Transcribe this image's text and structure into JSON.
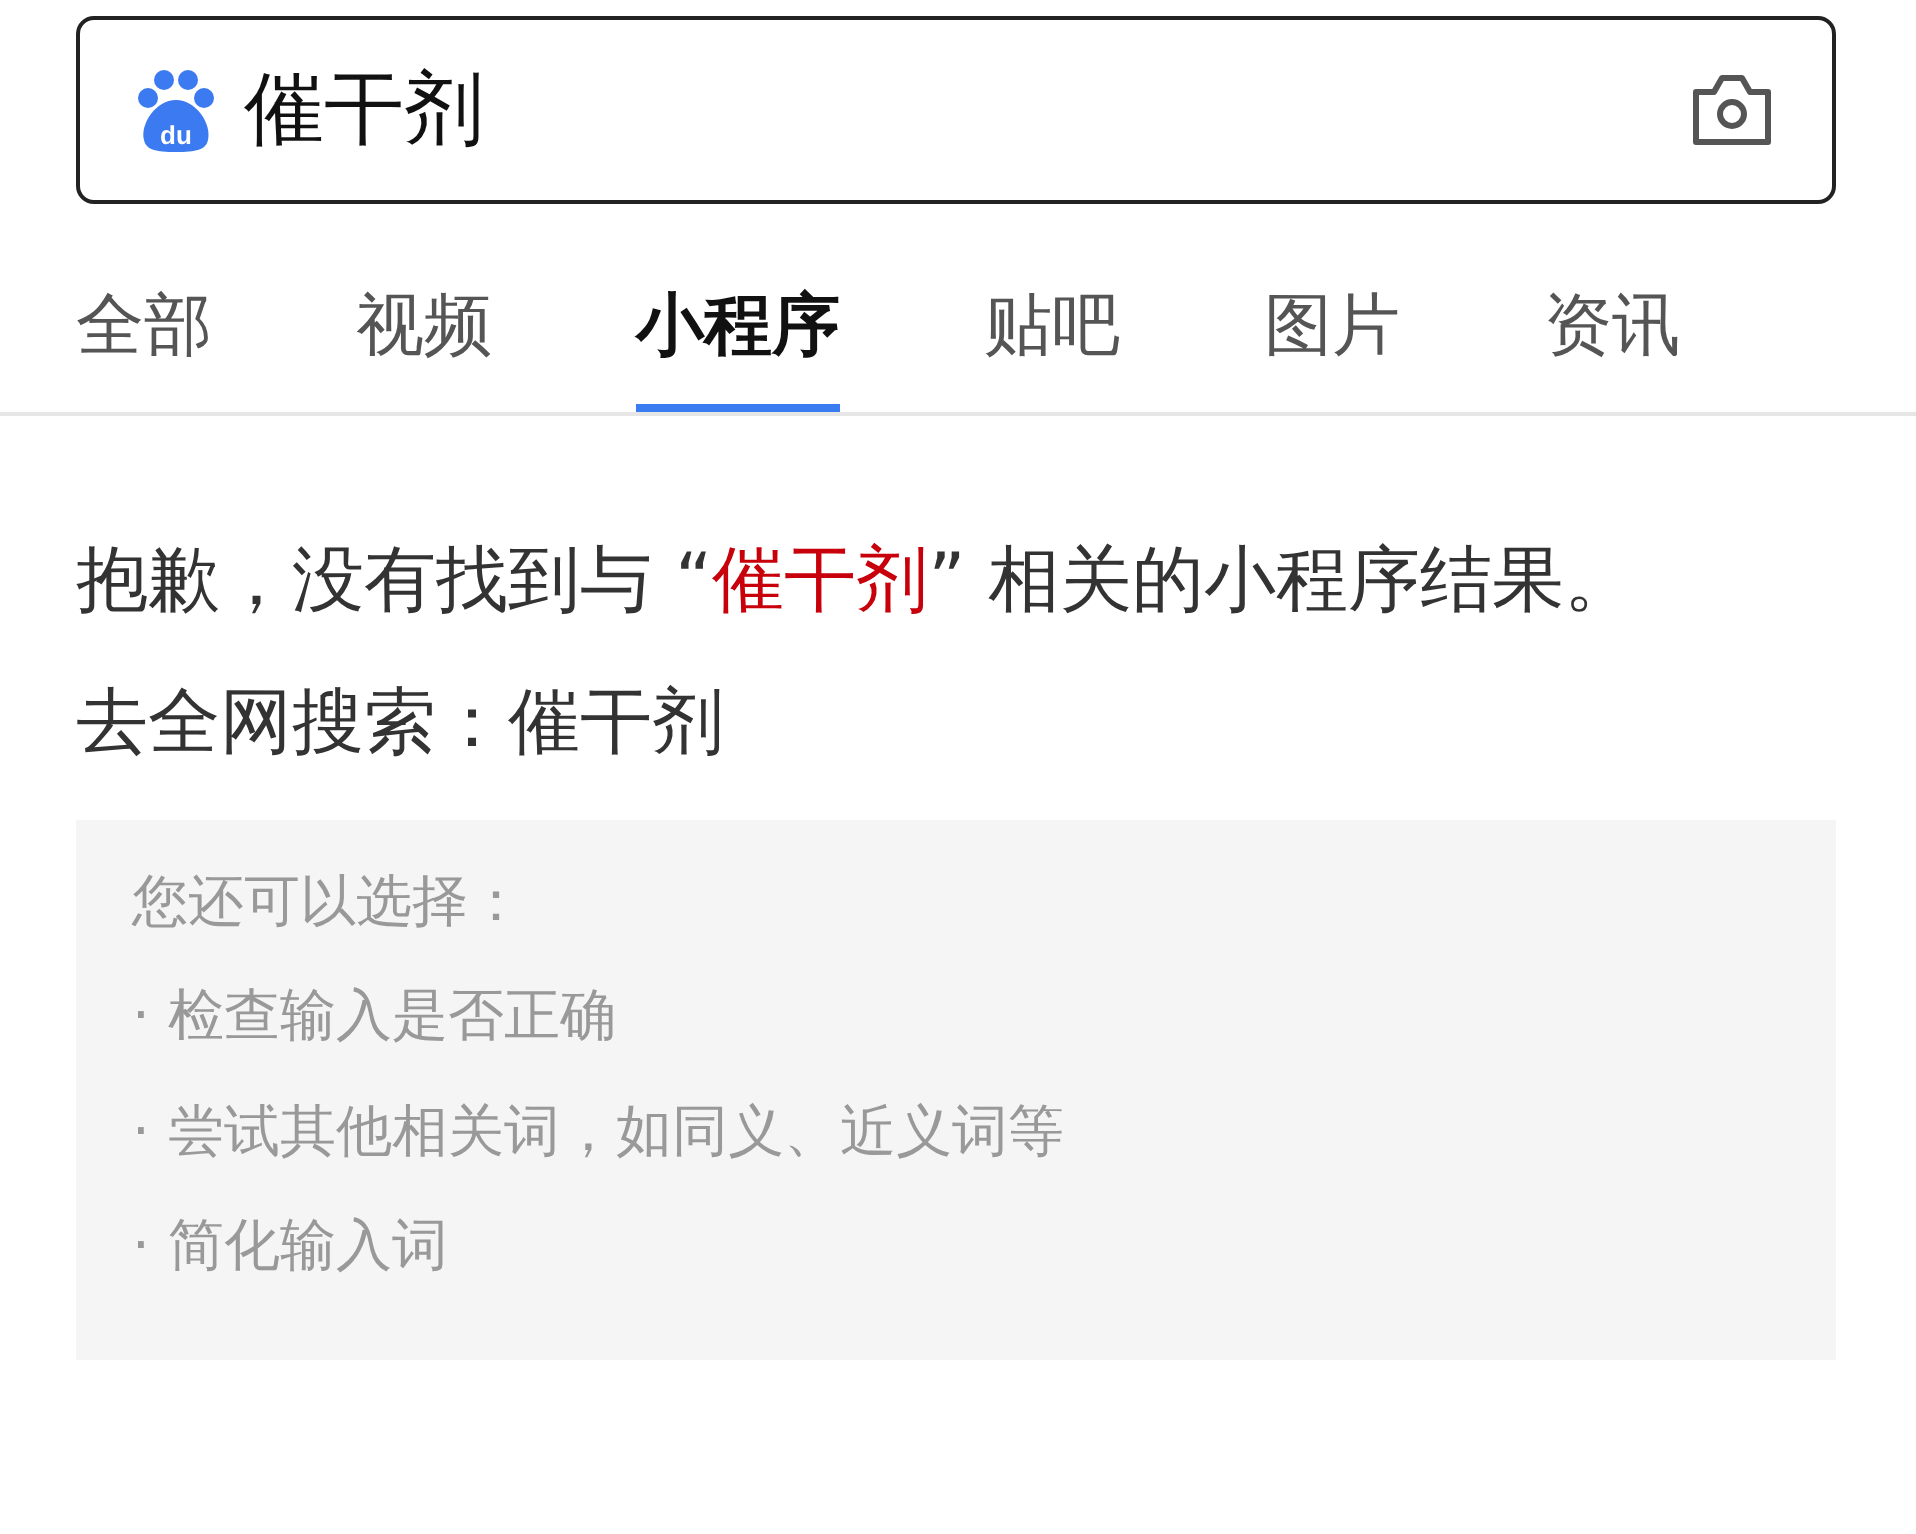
{
  "search": {
    "logo_text": "du",
    "query": "催干剂"
  },
  "tabs": [
    {
      "label": "全部",
      "selected": false
    },
    {
      "label": "视频",
      "selected": false
    },
    {
      "label": "小程序",
      "selected": true
    },
    {
      "label": "贴吧",
      "selected": false
    },
    {
      "label": "图片",
      "selected": false
    },
    {
      "label": "资讯",
      "selected": false
    }
  ],
  "message": {
    "before": "抱歉，没有找到与 “",
    "query": "催干剂",
    "after": "” 相关的小程序结果。"
  },
  "web_search": {
    "label": "去全网搜索：",
    "query": "催干剂"
  },
  "suggestions": {
    "title": "您还可以选择：",
    "items": [
      "· 检查输入是否正确",
      "· 尝试其他相关词，如同义、近义词等",
      "· 简化输入词"
    ]
  }
}
